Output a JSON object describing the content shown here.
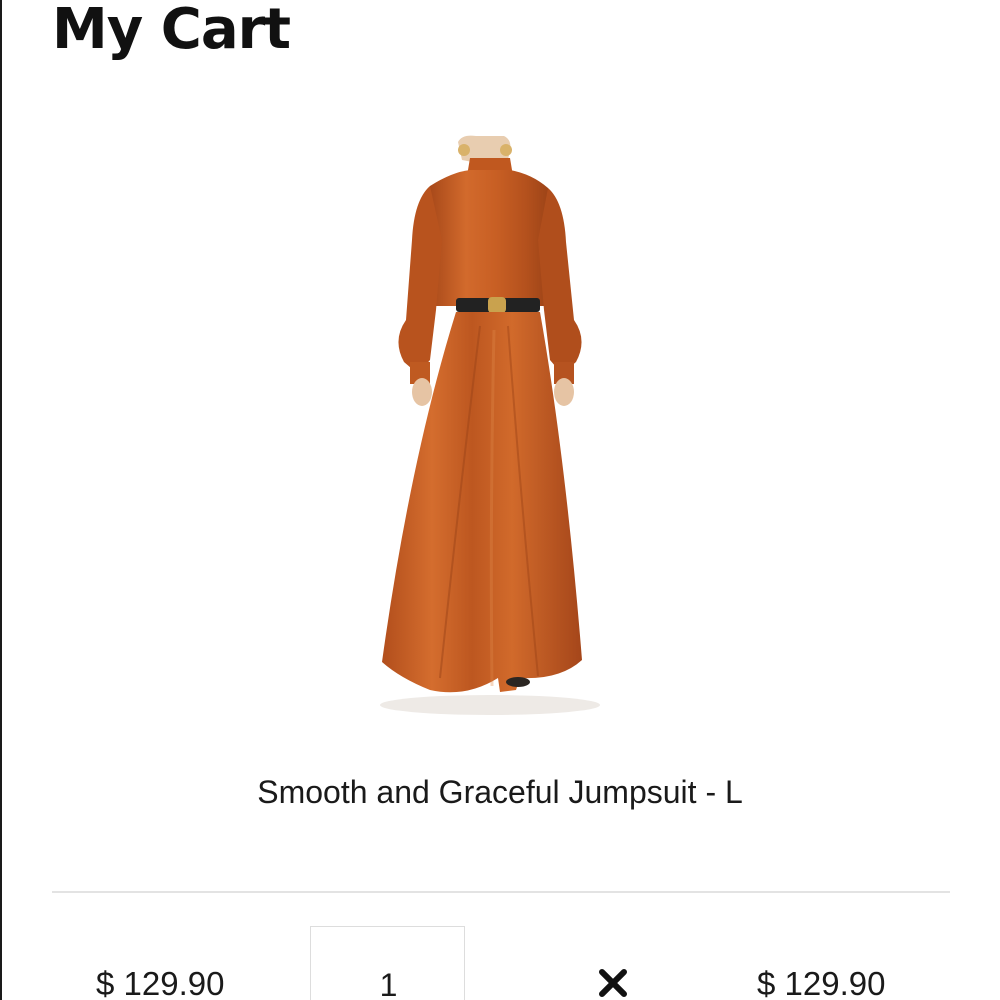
{
  "page": {
    "title": "My Cart"
  },
  "cart": {
    "items": [
      {
        "name": "Smooth and Graceful Jumpsuit - L",
        "image_icon": "orange-jumpsuit-product-photo",
        "product_color": "#c0581f",
        "unit_price": "$ 129.90",
        "quantity": "1",
        "remove_icon": "close-x-icon",
        "line_total": "$ 129.90"
      }
    ]
  }
}
